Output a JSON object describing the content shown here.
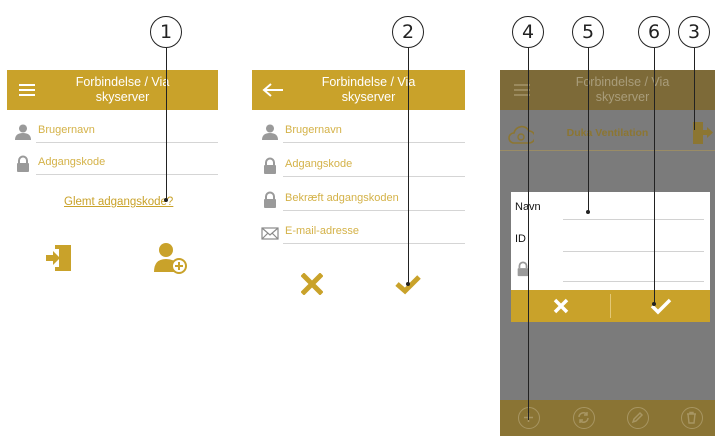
{
  "callouts": [
    "1",
    "2",
    "3",
    "4",
    "5",
    "6"
  ],
  "accent_color": "#c9a22a",
  "screen_login": {
    "title_line1": "Forbindelse / Via",
    "title_line2": "skyserver",
    "menu_icon": "hamburger-icon",
    "username_placeholder": "Brugernavn",
    "password_placeholder": "Adgangskode",
    "forgot_link": "Glemt adgangskode?",
    "login_icon": "login-door-icon",
    "register_icon": "add-user-icon"
  },
  "screen_register": {
    "title_line1": "Forbindelse / Via",
    "title_line2": "skyserver",
    "back_icon": "back-arrow-icon",
    "username_placeholder": "Brugernavn",
    "password_placeholder": "Adgangskode",
    "confirm_password_placeholder": "Bekræft adgangskoden",
    "email_placeholder": "E-mail-adresse",
    "cancel_icon": "close-icon",
    "confirm_icon": "checkmark-icon"
  },
  "screen_devices": {
    "title_line1": "Forbindelse / Via",
    "title_line2": "skyserver",
    "device_name": "Duka Ventilation",
    "dialog": {
      "name_label": "Navn",
      "id_label": "ID",
      "password_icon": "lock-icon",
      "cancel_icon": "close-icon",
      "confirm_icon": "checkmark-icon"
    },
    "bottom_icons": [
      "add-icon",
      "refresh-icon",
      "edit-icon",
      "delete-icon"
    ]
  }
}
